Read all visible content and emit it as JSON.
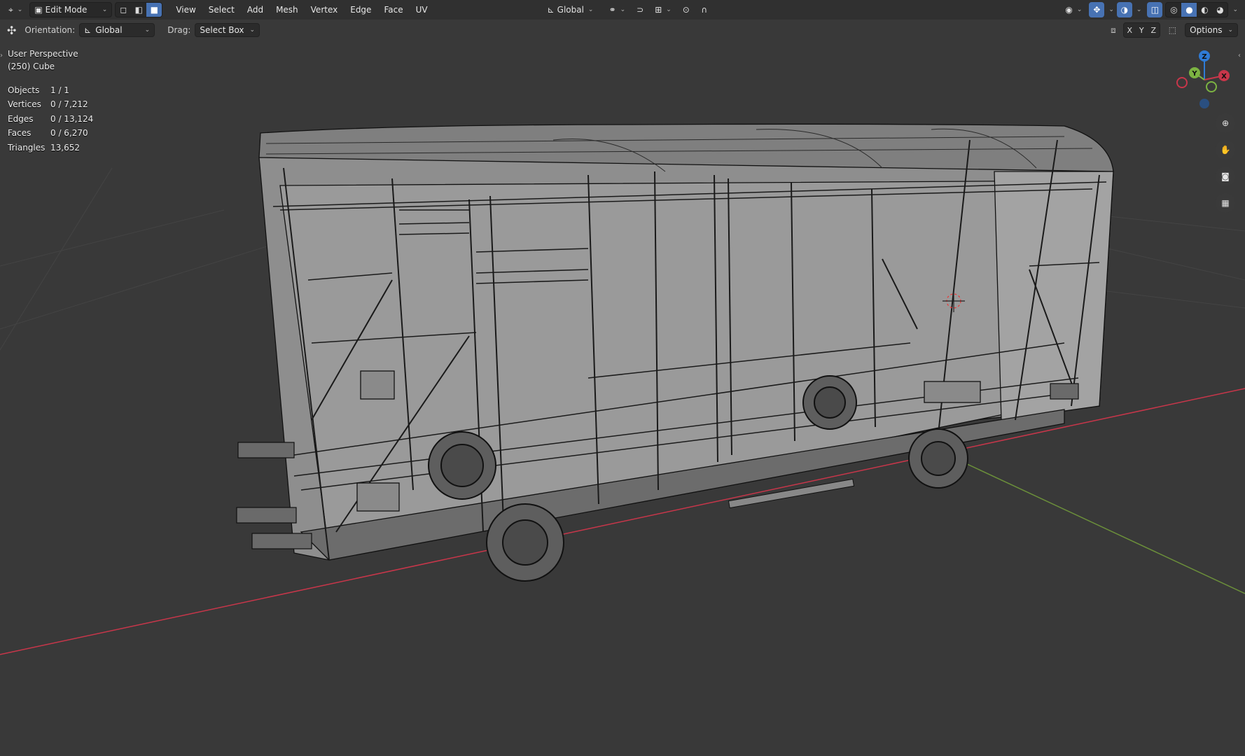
{
  "header": {
    "editor_type_icon": "view3d-icon",
    "mode": "Edit Mode",
    "select_modes": [
      "vertex-select",
      "edge-select",
      "face-select"
    ],
    "menus": [
      "View",
      "Select",
      "Add",
      "Mesh",
      "Vertex",
      "Edge",
      "Face",
      "UV"
    ],
    "transform_orientation": "Global",
    "icons_right": [
      "visibility-icon",
      "gizmo-icon",
      "overlay-icon",
      "xray-icon",
      "wireframe-shading-icon",
      "solid-shading-icon",
      "material-shading-icon",
      "rendered-shading-icon"
    ]
  },
  "toolbar": {
    "orientation_label": "Orientation:",
    "orientation_value": "Global",
    "drag_label": "Drag:",
    "drag_value": "Select Box",
    "axes": [
      "X",
      "Y",
      "Z"
    ],
    "options_label": "Options"
  },
  "viewport": {
    "perspective": "User Perspective",
    "object_name": "(250) Cube",
    "stats": [
      {
        "label": "Objects",
        "value": "1 / 1"
      },
      {
        "label": "Vertices",
        "value": "0 / 7,212"
      },
      {
        "label": "Edges",
        "value": "0 / 13,124"
      },
      {
        "label": "Faces",
        "value": "0 / 6,270"
      },
      {
        "label": "Triangles",
        "value": "13,652"
      }
    ]
  },
  "gizmo": {
    "x": "X",
    "y": "Y",
    "z": "Z"
  },
  "colors": {
    "accent": "#4772b3",
    "x_axis": "#c8364a",
    "y_axis": "#7cb342",
    "z_axis": "#2f7bd6",
    "background": "#393939"
  }
}
